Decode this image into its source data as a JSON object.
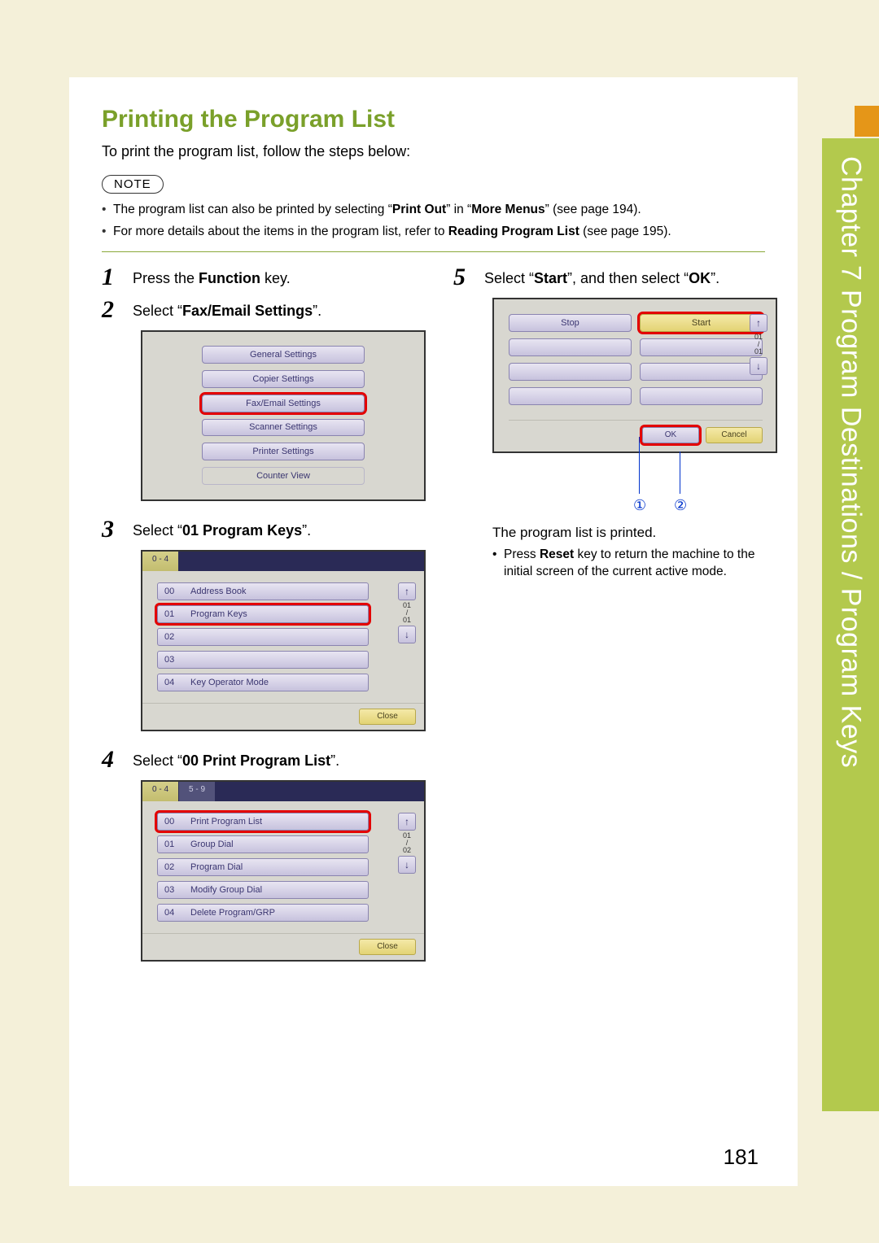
{
  "chapter": {
    "label_prefix": "Chapter",
    "number": "7",
    "title": "Program Destinations / Program Keys"
  },
  "page_number": "181",
  "section_title": "Printing the Program List",
  "intro": "To print the program list, follow the steps below:",
  "note_badge": "NOTE",
  "notes": [
    {
      "pre": "The program list can also be printed by selecting “",
      "b1": "Print Out",
      "mid": "” in “",
      "b2": "More Menus",
      "post": "” (see page 194)."
    },
    {
      "pre": "For more details about the items in the program list, refer to ",
      "b1": "Reading Program List",
      "mid": "",
      "b2": "",
      "post": " (see page 195)."
    }
  ],
  "steps": {
    "s1": {
      "num": "1",
      "pre": "Press the ",
      "b": "Function",
      "post": " key."
    },
    "s2": {
      "num": "2",
      "pre": "Select “",
      "b": "Fax/Email Settings",
      "post": "”."
    },
    "s3": {
      "num": "3",
      "pre": "Select “",
      "b": "01 Program Keys",
      "post": "”."
    },
    "s4": {
      "num": "4",
      "pre": "Select “",
      "b": "00 Print Program List",
      "post": "”."
    },
    "s5": {
      "num": "5",
      "pre": "Select “",
      "b1": "Start",
      "mid": "”, and then select “",
      "b2": "OK",
      "post": "”."
    }
  },
  "screens": {
    "s2": {
      "items": [
        "General Settings",
        "Copier Settings",
        "Fax/Email Settings",
        "Scanner Settings",
        "Printer Settings",
        "Counter View"
      ]
    },
    "s3": {
      "tab": "0 - 4",
      "rows": [
        {
          "n": "00",
          "t": "Address Book"
        },
        {
          "n": "01",
          "t": "Program Keys"
        },
        {
          "n": "02",
          "t": ""
        },
        {
          "n": "03",
          "t": ""
        },
        {
          "n": "04",
          "t": "Key Operator Mode"
        }
      ],
      "page_ind_top": "01",
      "page_ind_mid": "/",
      "page_ind_bot": "01",
      "close": "Close"
    },
    "s4": {
      "tab1": "0 - 4",
      "tab2": "5 - 9",
      "rows": [
        {
          "n": "00",
          "t": "Print Program List"
        },
        {
          "n": "01",
          "t": "Group Dial"
        },
        {
          "n": "02",
          "t": "Program Dial"
        },
        {
          "n": "03",
          "t": "Modify Group Dial"
        },
        {
          "n": "04",
          "t": "Delete Program/GRP"
        }
      ],
      "page_ind_top": "01",
      "page_ind_mid": "/",
      "page_ind_bot": "02",
      "close": "Close"
    },
    "s5": {
      "stop": "Stop",
      "start": "Start",
      "page_ind_top": "01",
      "page_ind_mid": "/",
      "page_ind_bot": "01",
      "ok": "OK",
      "cancel": "Cancel",
      "callout1": "①",
      "callout2": "②"
    }
  },
  "result_line": "The program list is printed.",
  "result_sub_pre": "Press ",
  "result_sub_b": "Reset",
  "result_sub_post": " key to return the machine to the initial screen of the current active mode."
}
